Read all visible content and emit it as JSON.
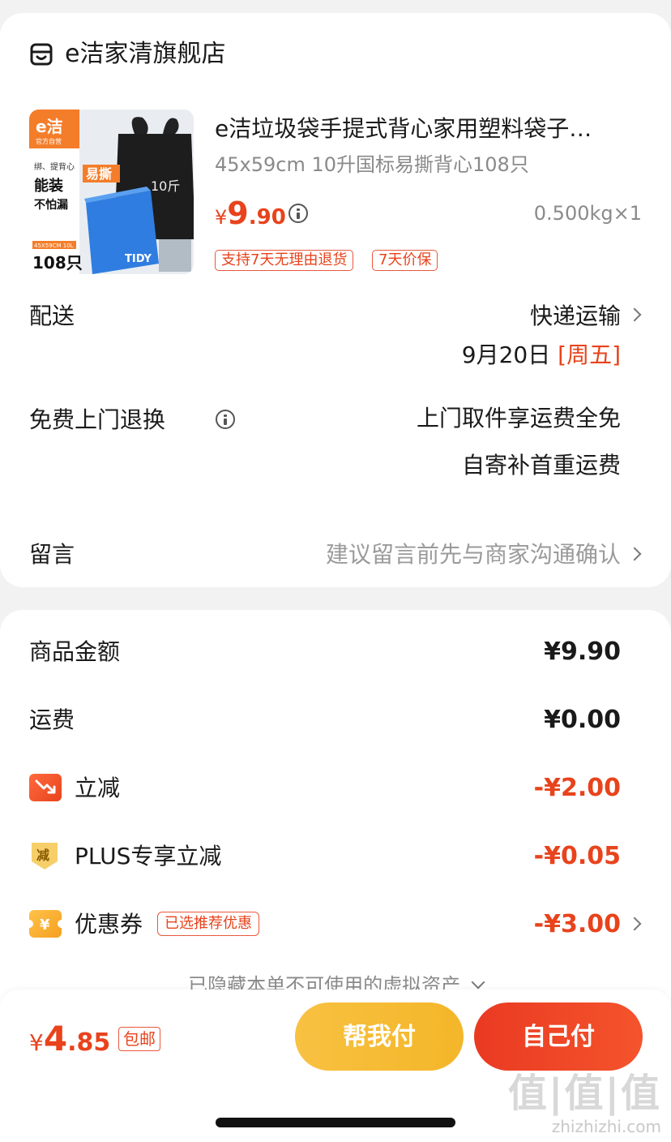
{
  "store": {
    "name": "e洁家清旗舰店",
    "icon": "store-icon"
  },
  "product": {
    "title": "e洁垃圾袋手提式背心家用塑料袋子…",
    "spec": "45x59cm 10升国标易撕背心108只",
    "price_currency": "¥",
    "price_int": "9",
    "price_dec": ".90",
    "weight_qty": "0.500kg×1",
    "tags": [
      "支持7天无理由退货",
      "7天价保"
    ],
    "thumb_text": {
      "brand": "e洁",
      "brand_sub": "官方自营",
      "line1": "绑、提背心",
      "line2": "能装",
      "line3": "不怕漏",
      "badge": "易撕",
      "bag_text": "10斤",
      "size": "45X59CM 10L",
      "count": "108只",
      "box_brand": "TIDY"
    }
  },
  "shipping": {
    "label": "配送",
    "method": "快递运输",
    "date": "9月20日",
    "weekday": "[周五]"
  },
  "returns": {
    "label": "免费上门退换",
    "line1": "上门取件享运费全免",
    "line2": "自寄补首重运费"
  },
  "message": {
    "label": "留言",
    "placeholder": "建议留言前先与商家沟通确认"
  },
  "amounts": {
    "goods_label": "商品金额",
    "goods_value": "¥9.90",
    "freight_label": "运费",
    "freight_value": "¥0.00",
    "discount_label": "立减",
    "discount_value": "-¥2.00",
    "plus_label": "PLUS专享立减",
    "plus_value": "-¥0.05",
    "plus_icon_text": "减",
    "coupon_label": "优惠券",
    "coupon_tag": "已选推荐优惠",
    "coupon_value": "-¥3.00",
    "coupon_icon_text": "¥"
  },
  "hidden_tip": "已隐藏本单不可使用的虚拟资产",
  "bottom": {
    "total_currency": "¥",
    "total_int": "4",
    "total_dec": ".85",
    "free_ship": "包邮",
    "help_pay": "帮我付",
    "self_pay": "自己付"
  },
  "watermark": {
    "logo": "值|值|值",
    "site": "zhizhizhi.com"
  },
  "colors": {
    "accent_red": "#e8431c",
    "yellow_button": "#f6bc34",
    "red_button": "#ef4726"
  }
}
